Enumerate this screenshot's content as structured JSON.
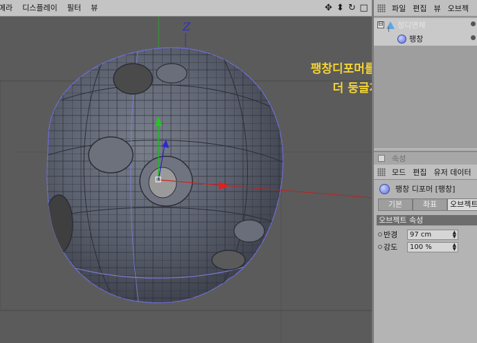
{
  "viewport": {
    "menu": [
      "메라",
      "디스플레이",
      "필터",
      "뷰"
    ],
    "nav_icons": [
      "move-icon",
      "zoom-icon",
      "rotate-icon",
      "maximize-icon"
    ],
    "nav_glyphs": [
      "✥",
      "⬍",
      "↻",
      "□"
    ],
    "axis_label": "Z",
    "annotation": "팽창디포머를 줘서 좀\n더 둥글게 ~",
    "annotation_color": "#f2d335"
  },
  "object_manager": {
    "menu": [
      "파일",
      "편집",
      "뷰",
      "오브젝"
    ],
    "objects": [
      {
        "name": "정디면체",
        "icon": "polyhedron-icon",
        "expander": "⊟"
      },
      {
        "name": "팽창",
        "icon": "sphere-deformer-icon"
      }
    ]
  },
  "attributes": {
    "header": "속성",
    "menu": [
      "모드",
      "편집",
      "유저 데이터"
    ],
    "title": "팽창 디포머 [팽창]",
    "tabs": [
      "기본",
      "좌표",
      "오브젝트"
    ],
    "section": "오브젝트 속성",
    "properties": [
      {
        "label": "반경",
        "value": "97 cm"
      },
      {
        "label": "강도",
        "value": "100 %"
      }
    ]
  }
}
